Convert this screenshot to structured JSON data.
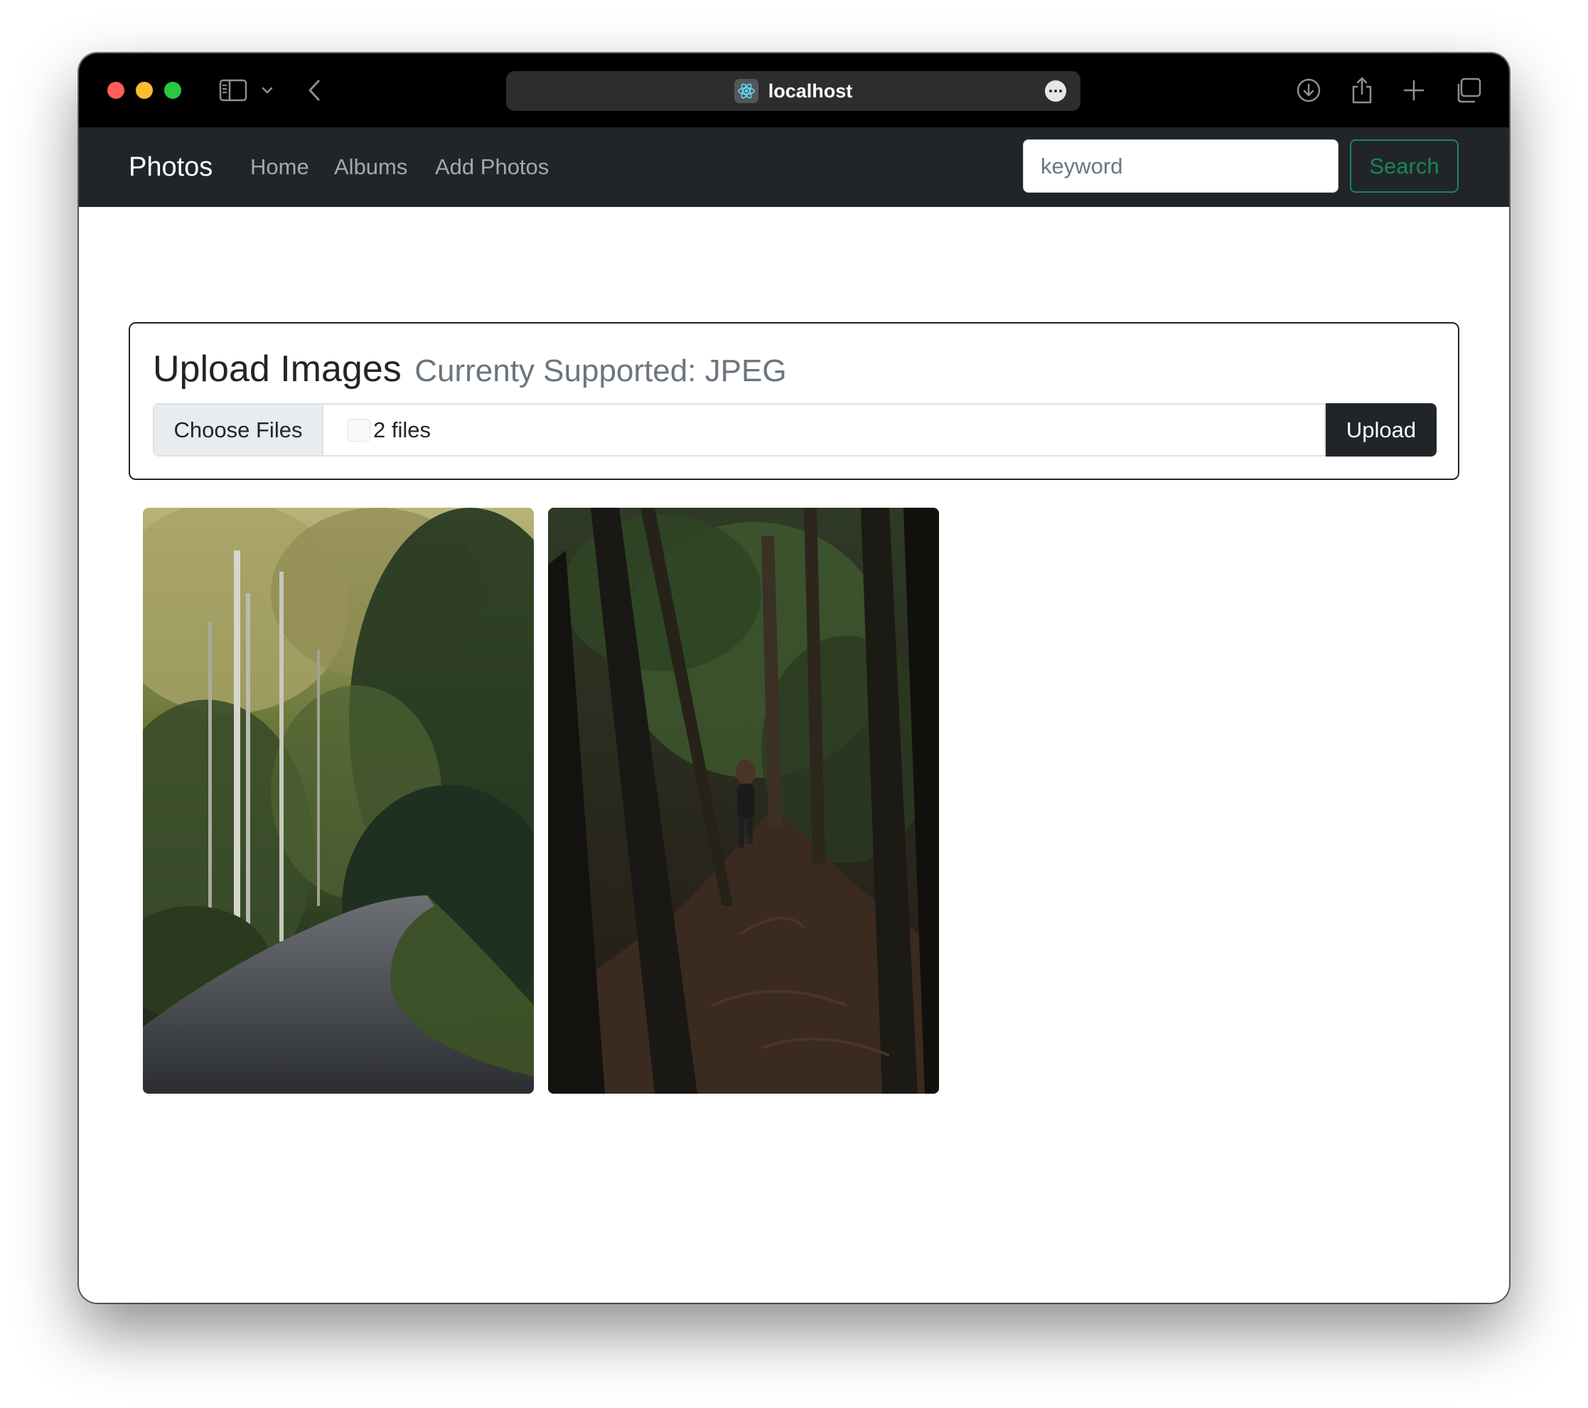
{
  "browser": {
    "address": "localhost",
    "icons": [
      "sidebar-icon",
      "chevron-down-icon",
      "back-icon",
      "react-icon",
      "more-icon",
      "download-icon",
      "share-icon",
      "new-tab-icon",
      "tabs-overview-icon"
    ]
  },
  "navbar": {
    "brand": "Photos",
    "links": [
      "Home",
      "Albums",
      "Add Photos"
    ],
    "search_placeholder": "keyword",
    "search_label": "Search"
  },
  "upload": {
    "title": "Upload Images",
    "subtitle": "Currenty Supported: JPEG",
    "choose_label": "Choose Files",
    "file_status": "2 files",
    "upload_label": "Upload"
  },
  "photos": [
    {
      "scene": "forest-path"
    },
    {
      "scene": "woods-hiker"
    }
  ],
  "colors": {
    "navbar": "#212529",
    "success": "#198754",
    "muted": "#6c757d"
  }
}
